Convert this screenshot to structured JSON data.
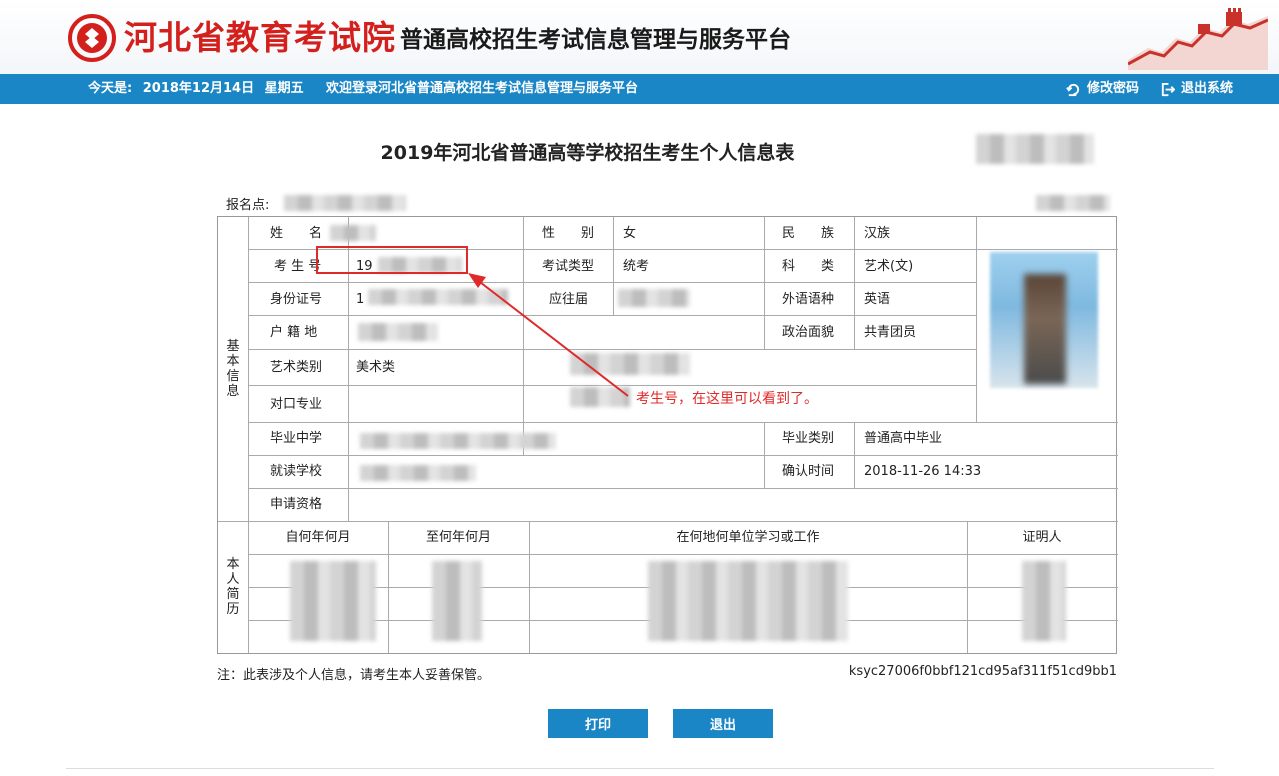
{
  "header": {
    "org_name": "河北省教育考试院",
    "platform_name": "普通高校招生考试信息管理与服务平台",
    "logo_icon": "exam-board-seal-icon",
    "decoration_icon": "great-wall-icon"
  },
  "topbar": {
    "today_label": "今天是:",
    "date": "2018年12月14日",
    "weekday": "星期五",
    "welcome": "欢迎登录河北省普通高校招生考试信息管理与服务平台",
    "change_password": "修改密码",
    "logout": "退出系统"
  },
  "form": {
    "title": "2019年河北省普通高等学校招生考生个人信息表",
    "site_label": "报名点:",
    "basic_section": "基本信息",
    "resume_section": "本人简历",
    "fields": {
      "name_label": "姓　　名",
      "gender_label": "性　　别",
      "gender_value": "女",
      "ethnicity_label": "民　　族",
      "ethnicity_value": "汉族",
      "exam_no_label": "考 生 号",
      "exam_no_value": "19",
      "exam_type_label": "考试类型",
      "exam_type_value": "统考",
      "subject_label": "科　　类",
      "subject_value": "艺术(文)",
      "id_label": "身份证号",
      "id_value": "1",
      "grad_year_label": "应往届",
      "language_label": "外语语种",
      "language_value": "英语",
      "hukou_label": "户 籍 地",
      "political_label": "政治面貌",
      "political_value": "共青团员",
      "art_category_label": "艺术类别",
      "art_category_value": "美术类",
      "counterpart_label": "对口专业",
      "graduate_school_label": "毕业中学",
      "graduate_type_label": "毕业类别",
      "graduate_type_value": "普通高中毕业",
      "current_school_label": "就读学校",
      "confirm_time_label": "确认时间",
      "confirm_time_value": "2018-11-26 14:33",
      "qualification_label": "申请资格"
    },
    "resume_headers": [
      "自何年何月",
      "至何年何月",
      "在何地何单位学习或工作",
      "证明人"
    ],
    "annotation": "考生号，在这里可以看到了。",
    "note": "注：此表涉及个人信息，请考生本人妥善保管。",
    "code": "ksyc27006f0bbf121cd95af311f51cd9bb1"
  },
  "actions": {
    "print": "打印",
    "exit": "退出"
  },
  "colors": {
    "brand_red": "#d4201d",
    "bar_blue": "#1b86c6",
    "annotation_red": "#e02a2a"
  }
}
